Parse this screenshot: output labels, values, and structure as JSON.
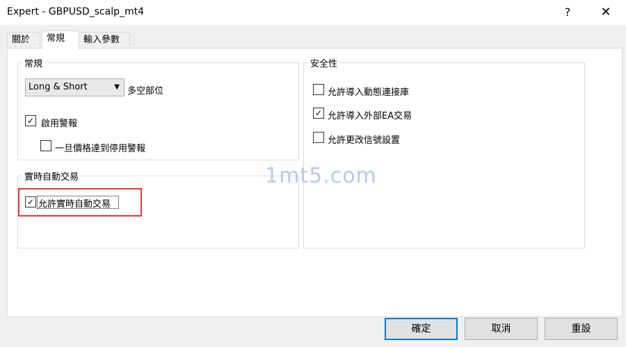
{
  "window": {
    "title": "Expert - GBPUSD_scalp_mt4",
    "help": "?",
    "close": "✕"
  },
  "tabs": [
    {
      "label": "關於"
    },
    {
      "label": "常規"
    },
    {
      "label": "輸入參數"
    }
  ],
  "general": {
    "title": "常規",
    "direction": {
      "value": "Long & Short",
      "label": "多空部位"
    },
    "enable_alerts": {
      "label": "啟用警報",
      "checked": true
    },
    "disable_alert_once": {
      "label": "一旦價格達到停用警報",
      "checked": false
    }
  },
  "live_trading": {
    "title": "實時自動交易",
    "allow": {
      "label": "允許實時自動交易",
      "checked": true
    }
  },
  "security": {
    "title": "安全性",
    "dll": {
      "label": "允許導入動態連接庫",
      "checked": false
    },
    "ea": {
      "label": "允許導入外部EA交易",
      "checked": true
    },
    "signals": {
      "label": "允許更改信號設置",
      "checked": false
    }
  },
  "watermark": "1mt5.com",
  "buttons": {
    "ok": "確定",
    "cancel": "取消",
    "reset": "重設"
  }
}
